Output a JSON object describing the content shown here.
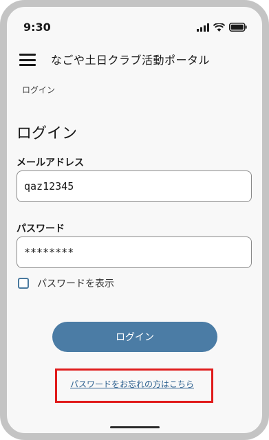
{
  "status_bar": {
    "time": "9:30",
    "icons": [
      "signal-icon",
      "wifi-icon",
      "battery-icon"
    ]
  },
  "header": {
    "menu_icon": "hamburger-menu-icon",
    "title": "なごや土日クラブ活動ポータル"
  },
  "breadcrumb": "ログイン",
  "page_title": "ログイン",
  "form": {
    "email_label": "メールアドレス",
    "email_value": "qaz12345",
    "password_label": "パスワード",
    "password_value": "********",
    "show_password_label": "パスワードを表示",
    "show_password_checked": false
  },
  "login_button_label": "ログイン",
  "forgot_password_link": "パスワードをお忘れの方はこちら",
  "colors": {
    "accent": "#4b7ca5",
    "link": "#2b5f8e",
    "highlight": "#e01b1b"
  }
}
